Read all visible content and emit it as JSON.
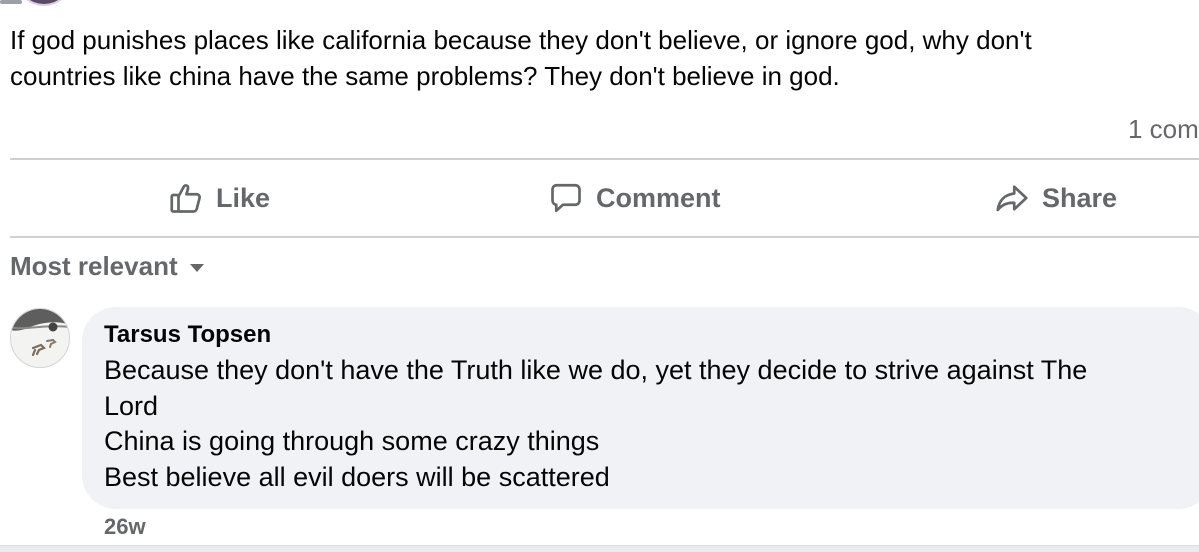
{
  "post": {
    "text_line1": "If god punishes places like california because they don't believe, or ignore god, why don't",
    "text_line2": "countries like china have the same problems? They don't believe in god.",
    "comment_count": "1 com"
  },
  "actions": {
    "like": {
      "label": "Like",
      "icon": "thumbs-up-icon"
    },
    "comment": {
      "label": "Comment",
      "icon": "speech-bubble-icon"
    },
    "share": {
      "label": "Share",
      "icon": "share-arrow-icon"
    }
  },
  "sort": {
    "label": "Most relevant",
    "icon": "caret-down-icon"
  },
  "comment": {
    "author": "Tarsus Topsen",
    "lines": [
      "Because they don't have the Truth like we do, yet they decide to strive against The",
      "Lord",
      "China is going through some crazy things",
      "Best believe all evil doers will be scattered"
    ],
    "timestamp": "26w"
  },
  "colors": {
    "text_primary": "#050505",
    "text_secondary": "#65676b",
    "bubble_bg": "#f0f2f5",
    "divider": "#ced0d4"
  }
}
